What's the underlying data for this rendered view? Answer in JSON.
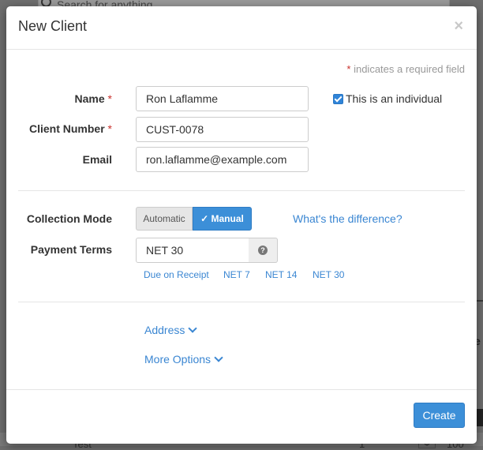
{
  "background": {
    "search_placeholder": "Search for anything",
    "row_text": "Test",
    "row_qty": "1",
    "row_currency": "$",
    "row_value": "100",
    "right_letter": "e"
  },
  "modal": {
    "title": "New Client",
    "close_symbol": "×",
    "required_note_star": "*",
    "required_note_text": " indicates a required field"
  },
  "form": {
    "name_label": "Name",
    "name_value": "Ron Laflamme",
    "client_number_label": "Client Number",
    "client_number_value": "CUST-0078",
    "email_label": "Email",
    "email_value": "ron.laflamme@example.com",
    "required_star": "*",
    "individual_label": "This is an individual",
    "individual_checked": true,
    "collection_mode_label": "Collection Mode",
    "collection_automatic": "Automatic",
    "collection_manual": "✓ Manual",
    "difference_link": "What's the difference?",
    "payment_terms_label": "Payment Terms",
    "payment_terms_value": "NET 30",
    "payment_term_options": [
      "Due on Receipt",
      "NET 7",
      "NET 14",
      "NET 30"
    ],
    "address_link": "Address",
    "more_options_link": "More Options"
  },
  "footer": {
    "create_label": "Create"
  },
  "colors": {
    "accent": "#3c8fd8",
    "required": "#c9302c",
    "link": "#3a86d2"
  },
  "icons": {
    "help": "question-circle-icon",
    "chevron": "chevron-down-icon",
    "close": "close-icon",
    "search": "search-icon"
  }
}
